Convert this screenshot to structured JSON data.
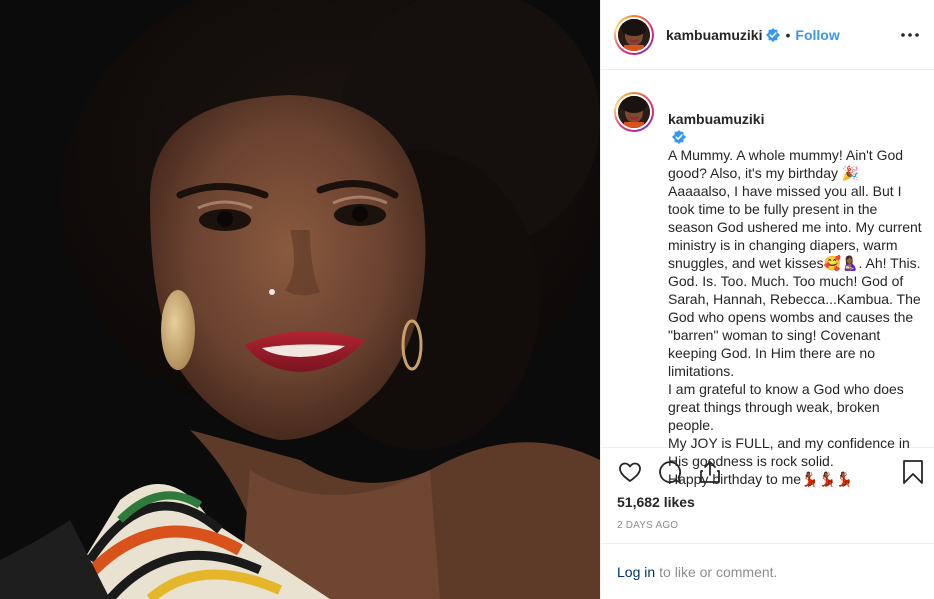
{
  "post": {
    "username": "kambuamuziki",
    "dot": "•",
    "follow_label": "Follow",
    "caption_lines": [
      "A Mummy. A whole mummy! Ain't God good? Also, it's my birthday 🎉 Aaaaalso, I have missed you all. But I took time to be fully present in the season God ushered me into. My current ministry is in changing diapers, warm snuggles, and wet kisses🥰🤱🏾. Ah! This. God. Is. Too. Much. Too much! God of Sarah, Hannah, Rebecca...Kambua. The God who opens wombs and causes the \"barren\" woman to sing! Covenant keeping God. In Him there are no limitations.",
      "I am grateful to know a God who does great things through weak, broken people.",
      "My JOY is FULL, and my confidence in His goodness is rock solid.",
      "Happy birthday to me💃🏾💃🏾💃🏾"
    ],
    "likes": "51,682 likes",
    "time_ago": "2 DAYS AGO"
  },
  "comment_bar": {
    "login_label": "Log in",
    "rest_text": "to like or comment."
  },
  "icons": {
    "verified": "verified-badge-icon",
    "more": "more-options-icon",
    "like": "heart-icon",
    "comment": "comment-bubble-icon",
    "share": "share-icon",
    "save": "bookmark-icon"
  },
  "colors": {
    "accent": "#3897f0",
    "link": "#003569",
    "muted": "#8e8e8e",
    "text": "#262626",
    "border": "#efefef"
  }
}
